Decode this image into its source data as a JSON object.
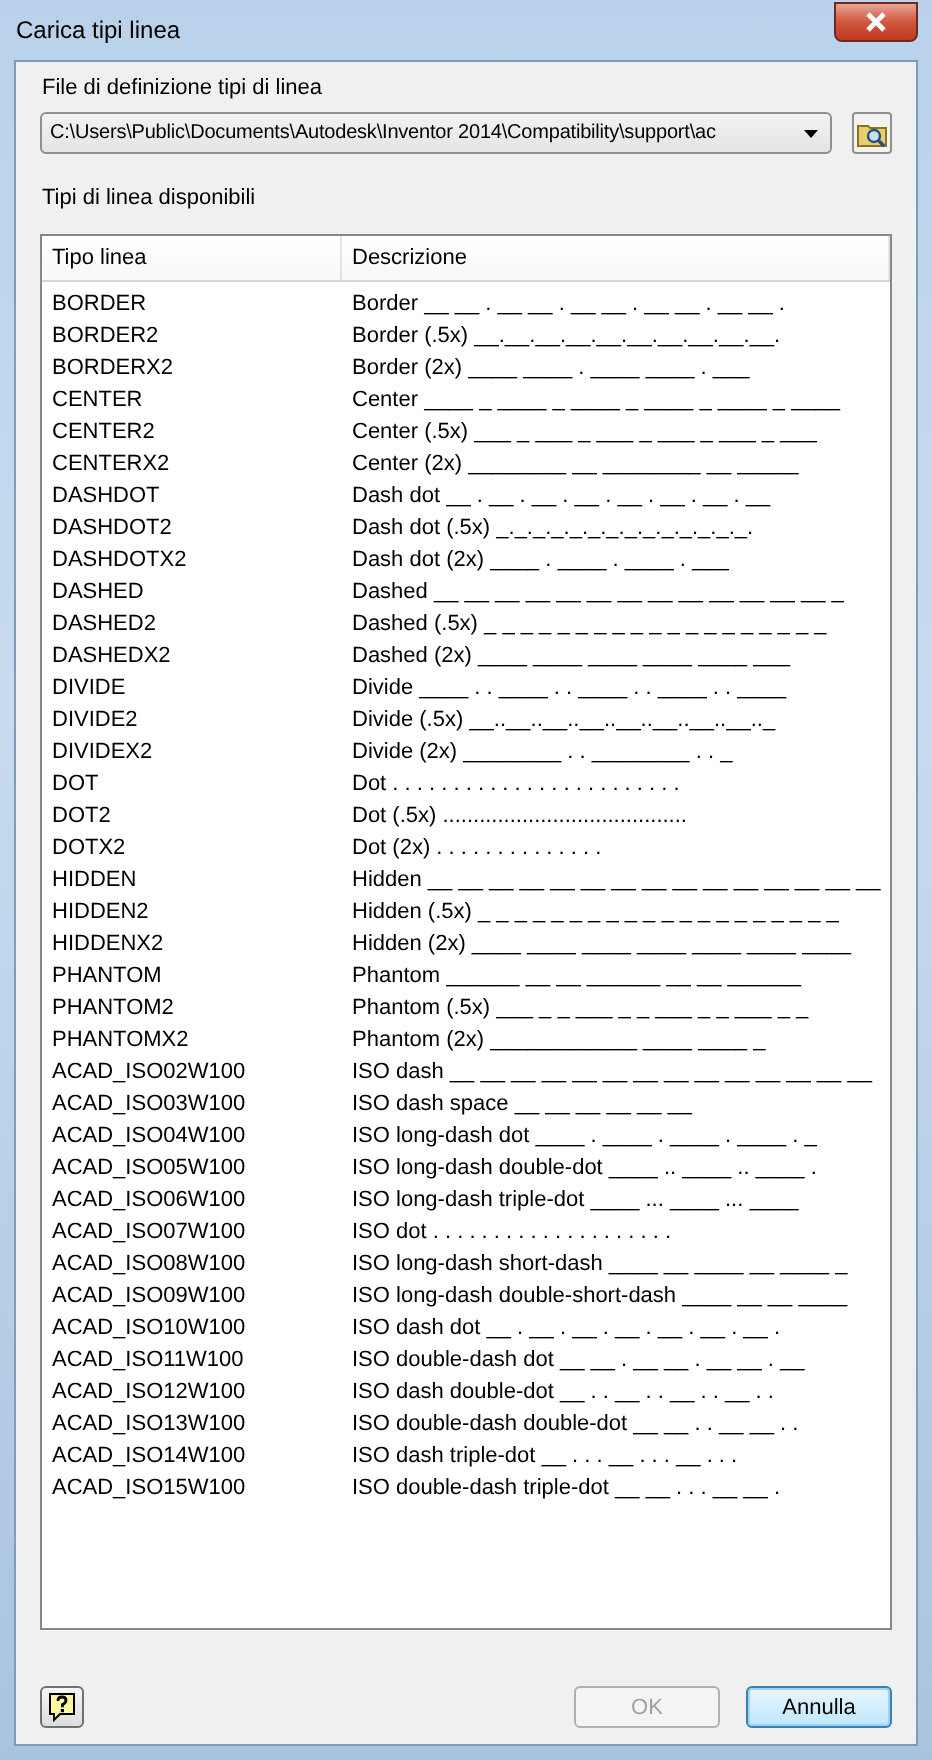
{
  "window": {
    "title": "Carica tipi linea"
  },
  "file_section": {
    "label": "File di definizione tipi di linea",
    "path": "C:\\Users\\Public\\Documents\\Autodesk\\Inventor 2014\\Compatibility\\support\\ac"
  },
  "list_section": {
    "label": "Tipi di linea disponibili"
  },
  "table": {
    "columns": [
      "Tipo linea",
      "Descrizione"
    ],
    "rows": [
      [
        "BORDER",
        "Border __ __ . __ __ . __ __ . __ __ . __ __ ."
      ],
      [
        "BORDER2",
        "Border (.5x) __.__.__.__.__.__.__.__.__.__."
      ],
      [
        "BORDERX2",
        "Border (2x) ____ ____ . ____ ____ . ___"
      ],
      [
        "CENTER",
        "Center ____ _ ____ _ ____ _ ____ _ ____ _ ____"
      ],
      [
        "CENTER2",
        "Center (.5x) ___ _ ___ _ ___ _ ___ _ ___ _ ___"
      ],
      [
        "CENTERX2",
        "Center (2x) ________ __ ________ __ _____"
      ],
      [
        "DASHDOT",
        "Dash dot __ . __ . __ . __ . __ . __ . __ . __"
      ],
      [
        "DASHDOT2",
        "Dash dot (.5x) _._._._._._._._._._._._._._."
      ],
      [
        "DASHDOTX2",
        "Dash dot (2x) ____ . ____ . ____ . ___"
      ],
      [
        "DASHED",
        "Dashed __ __ __ __ __ __ __ __ __ __ __ __ __ _"
      ],
      [
        "DASHED2",
        "Dashed (.5x) _ _ _ _ _ _ _ _ _ _ _ _ _ _ _ _ _ _ _"
      ],
      [
        "DASHEDX2",
        "Dashed (2x) ____ ____ ____ ____ ____ ___"
      ],
      [
        "DIVIDE",
        "Divide ____ . . ____ . . ____ . . ____ . . ____"
      ],
      [
        "DIVIDE2",
        "Divide (.5x) __..__..__..__..__..__..__..__.._"
      ],
      [
        "DIVIDEX2",
        "Divide (2x) ________ . . ________ . . _"
      ],
      [
        "DOT",
        "Dot . . . . . . . . . . . . . . . . . . . . . . . ."
      ],
      [
        "DOT2",
        "Dot (.5x) ........................................"
      ],
      [
        "DOTX2",
        "Dot (2x) . . . . . . . . . . . . . ."
      ],
      [
        "HIDDEN",
        "Hidden __ __ __ __ __ __ __ __ __ __ __ __ __ __ __"
      ],
      [
        "HIDDEN2",
        "Hidden (.5x) _ _ _ _ _ _ _ _ _ _ _ _ _ _ _ _ _ _ _ _"
      ],
      [
        "HIDDENX2",
        "Hidden (2x) ____ ____ ____ ____ ____ ____ ____"
      ],
      [
        "PHANTOM",
        "Phantom ______ __ __ ______ __ __ ______"
      ],
      [
        "PHANTOM2",
        "Phantom (.5x) ___ _ _ ___ _ _ ___ _ _ ___ _ _"
      ],
      [
        "PHANTOMX2",
        "Phantom (2x) ____________ ____ ____ _"
      ],
      [
        "ACAD_ISO02W100",
        "ISO dash __ __ __ __ __ __ __ __ __ __ __ __ __ __"
      ],
      [
        "ACAD_ISO03W100",
        "ISO dash space __ __ __ __ __ __"
      ],
      [
        "ACAD_ISO04W100",
        "ISO long-dash dot ____ . ____ . ____ . ____ . _"
      ],
      [
        "ACAD_ISO05W100",
        "ISO long-dash double-dot ____ .. ____ .. ____ ."
      ],
      [
        "ACAD_ISO06W100",
        "ISO long-dash triple-dot ____ ... ____ ... ____"
      ],
      [
        "ACAD_ISO07W100",
        "ISO dot . . . . . . . . . . . . . . . . . . . ."
      ],
      [
        "ACAD_ISO08W100",
        "ISO long-dash short-dash ____ __ ____ __ ____ _"
      ],
      [
        "ACAD_ISO09W100",
        "ISO long-dash double-short-dash ____ __ __ ____"
      ],
      [
        "ACAD_ISO10W100",
        "ISO dash dot __ . __ . __ . __ . __ . __ . __ ."
      ],
      [
        "ACAD_ISO11W100",
        "ISO double-dash dot __ __ . __ __ . __ __ . __"
      ],
      [
        "ACAD_ISO12W100",
        "ISO dash double-dot __ . . __ . . __ . . __ . ."
      ],
      [
        "ACAD_ISO13W100",
        "ISO double-dash double-dot __ __ . . __ __ . ."
      ],
      [
        "ACAD_ISO14W100",
        "ISO dash triple-dot __ . . . __ . . . __ . . ."
      ],
      [
        "ACAD_ISO15W100",
        "ISO double-dash triple-dot __ __ . . . __ __ ."
      ]
    ]
  },
  "buttons": [
    {
      "label": "OK",
      "disabled": true,
      "default": false
    },
    {
      "label": "Annulla",
      "disabled": false,
      "default": true
    }
  ]
}
